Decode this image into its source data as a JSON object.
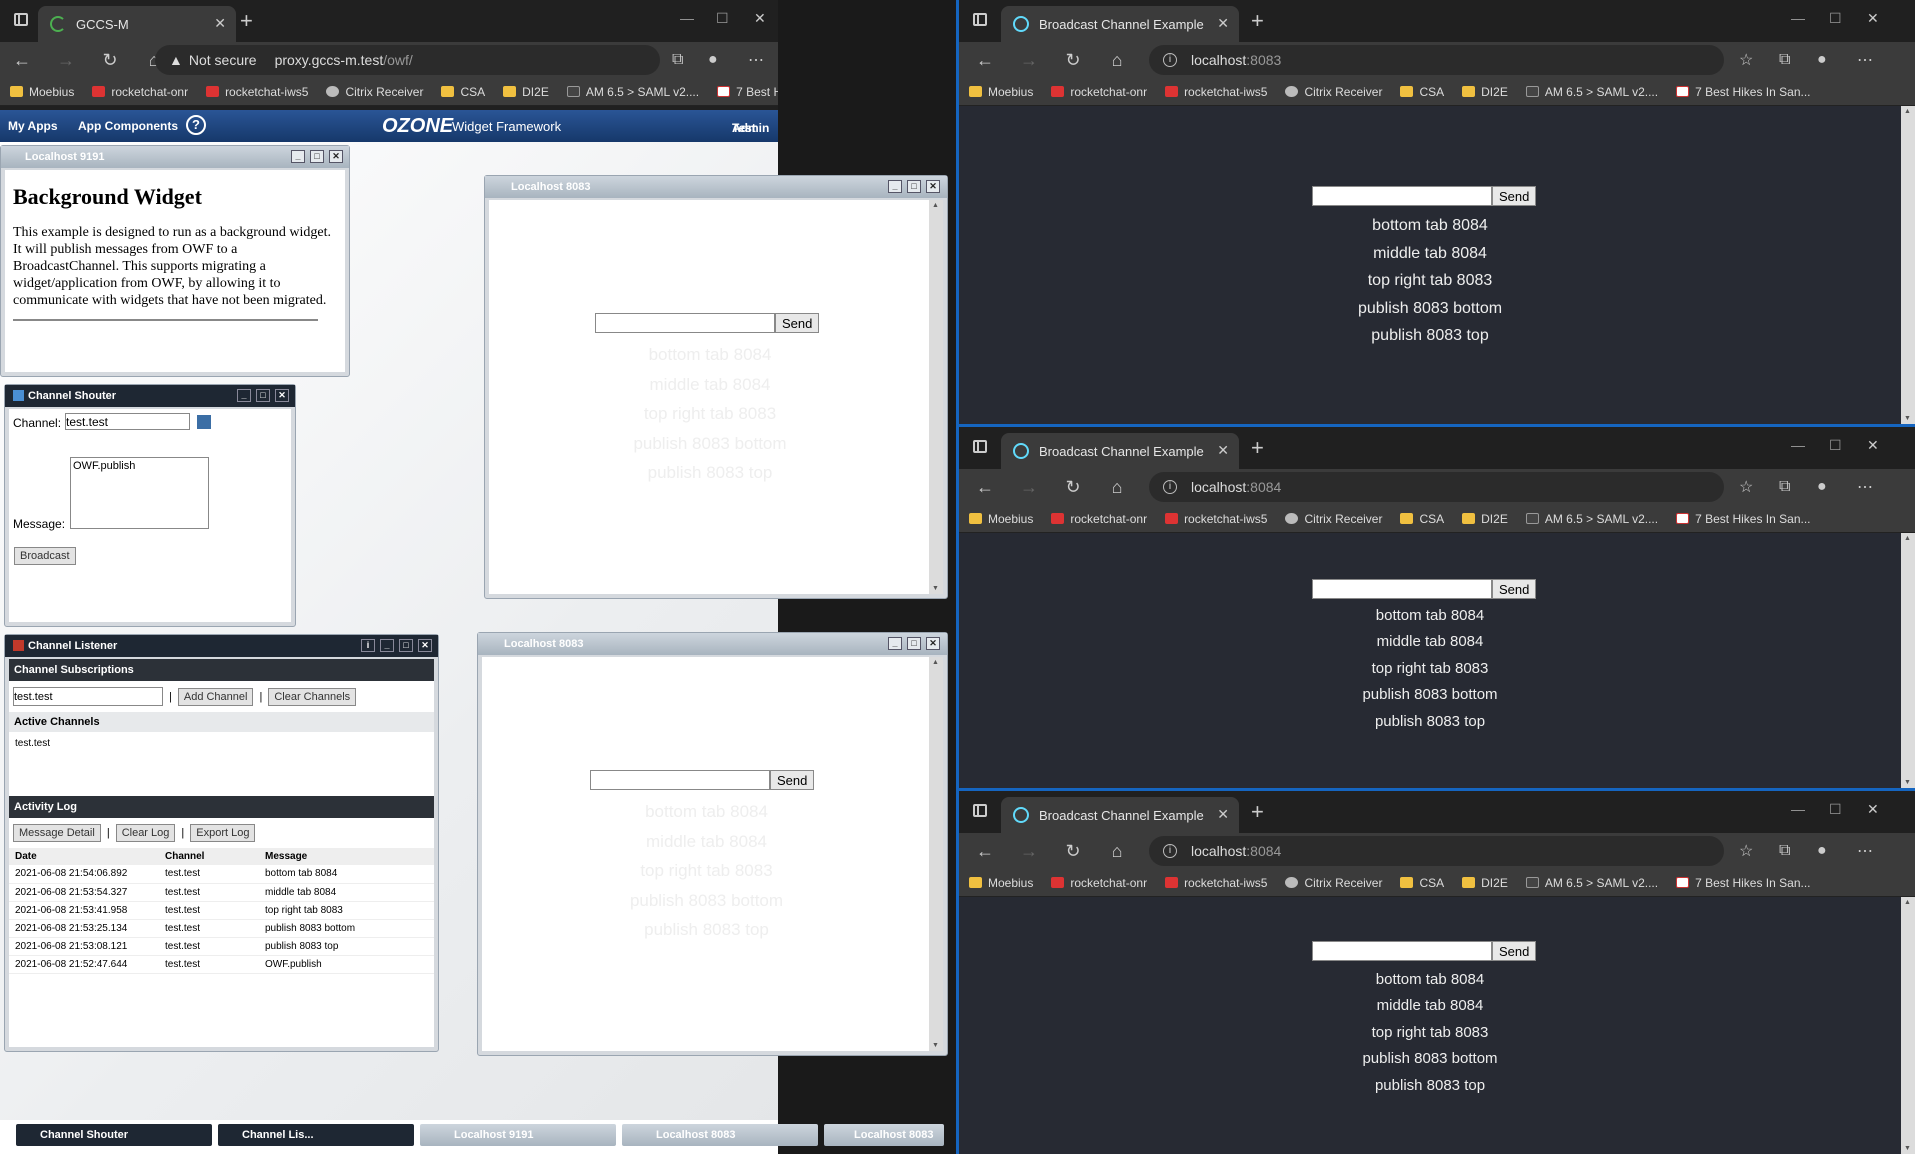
{
  "left_browser": {
    "tab_title": "GCCS-M",
    "security": "Not secure",
    "url_host": "proxy.gccs-m.test",
    "url_path": "/owf/",
    "bookmarks": [
      "Moebius",
      "rocketchat-onr",
      "rocketchat-iws5",
      "Citrix Receiver",
      "CSA",
      "DI2E",
      "AM 6.5 > SAML v2....",
      "7 Best Hikes In San..."
    ]
  },
  "owf": {
    "menu_myapps": "My Apps",
    "menu_components": "App Components",
    "help": "?",
    "logo": "OZONE",
    "logo_sub": "Widget Framework",
    "user_line1": "Test",
    "user_line2": "Admin",
    "bg_widget": {
      "title": "Localhost 9191",
      "heading": "Background Widget",
      "body": "This example is designed to run as a background widget. It will publish messages from OWF to a BroadcastChannel. This supports migrating a widget/application from OWF, by allowing it to communicate with widgets that have not been migrated."
    },
    "shouter": {
      "title": "Channel Shouter",
      "channel_label": "Channel:",
      "channel_value": "test.test",
      "message_label": "Message:",
      "message_value": "OWF.publish",
      "broadcast": "Broadcast"
    },
    "listener": {
      "title": "Channel Listener",
      "subs_header": "Channel Subscriptions",
      "channel_value": "test.test",
      "add": "Add Channel",
      "clear": "Clear Channels",
      "active_header": "Active Channels",
      "active": [
        "test.test"
      ],
      "log_header": "Activity Log",
      "detail": "Message Detail",
      "clear_log": "Clear Log",
      "export": "Export Log",
      "cols": [
        "Date",
        "Channel",
        "Message"
      ],
      "rows": [
        [
          "2021-06-08 21:54:06.892",
          "test.test",
          "bottom tab 8084"
        ],
        [
          "2021-06-08 21:53:54.327",
          "test.test",
          "middle tab 8084"
        ],
        [
          "2021-06-08 21:53:41.958",
          "test.test",
          "top right tab 8083"
        ],
        [
          "2021-06-08 21:53:25.134",
          "test.test",
          "publish 8083 bottom"
        ],
        [
          "2021-06-08 21:53:08.121",
          "test.test",
          "publish 8083 top"
        ],
        [
          "2021-06-08 21:52:47.644",
          "test.test",
          "OWF.publish"
        ]
      ]
    },
    "w8083_title": "Localhost 8083",
    "taskbar": [
      "Channel Shouter",
      "Channel Lis...",
      "Localhost 9191",
      "Localhost 8083",
      "Localhost 8083"
    ]
  },
  "send_label": "Send",
  "messages": [
    "bottom tab 8084",
    "middle tab 8084",
    "top right tab 8083",
    "publish 8083 bottom",
    "publish 8083 top"
  ],
  "right_browsers": [
    {
      "tab_title": "Broadcast Channel Example",
      "url_host": "localhost",
      "url_port": ":8083"
    },
    {
      "tab_title": "Broadcast Channel Example",
      "url_host": "localhost",
      "url_port": ":8084"
    },
    {
      "tab_title": "Broadcast Channel Example",
      "url_host": "localhost",
      "url_port": ":8084"
    }
  ],
  "colors": {
    "accent": "#1565c0",
    "owf_bar": "#1d4a85",
    "page_bg": "#272a33"
  }
}
